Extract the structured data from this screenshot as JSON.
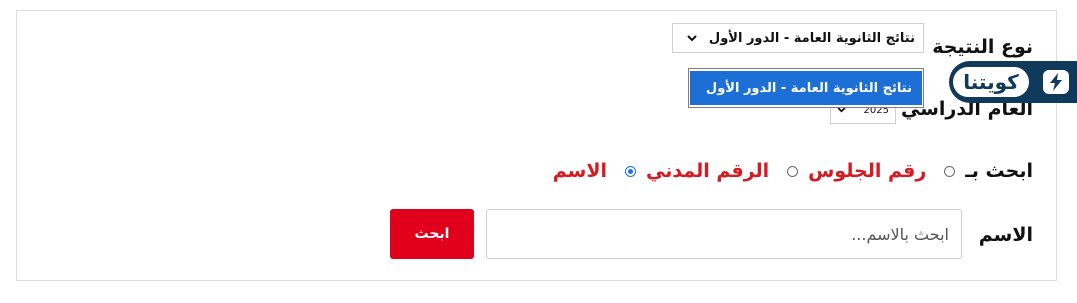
{
  "result_type": {
    "label": "نوع النتيجة",
    "selected": "نتائج الثانوية العامة - الدور الأول",
    "options": [
      "نتائج الثانوية العامة - الدور الأول"
    ]
  },
  "academic_year": {
    "label": "العام الدراسي",
    "selected": "2025"
  },
  "search_by": {
    "label": "ابحث بـ",
    "options": [
      {
        "label": "رقم الجلوس",
        "checked": false
      },
      {
        "label": "الرقم المدني",
        "checked": false
      },
      {
        "label": "الاسم",
        "checked": true
      }
    ]
  },
  "name_search": {
    "label": "الاسم",
    "placeholder": "ابحث بالاسم...",
    "button_label": "ابحث"
  },
  "logo": {
    "text": "كويتنا",
    "bg_color": "#0f3a5c"
  },
  "colors": {
    "accent_red": "#e0001b",
    "option_highlight": "#1d6fd6"
  }
}
